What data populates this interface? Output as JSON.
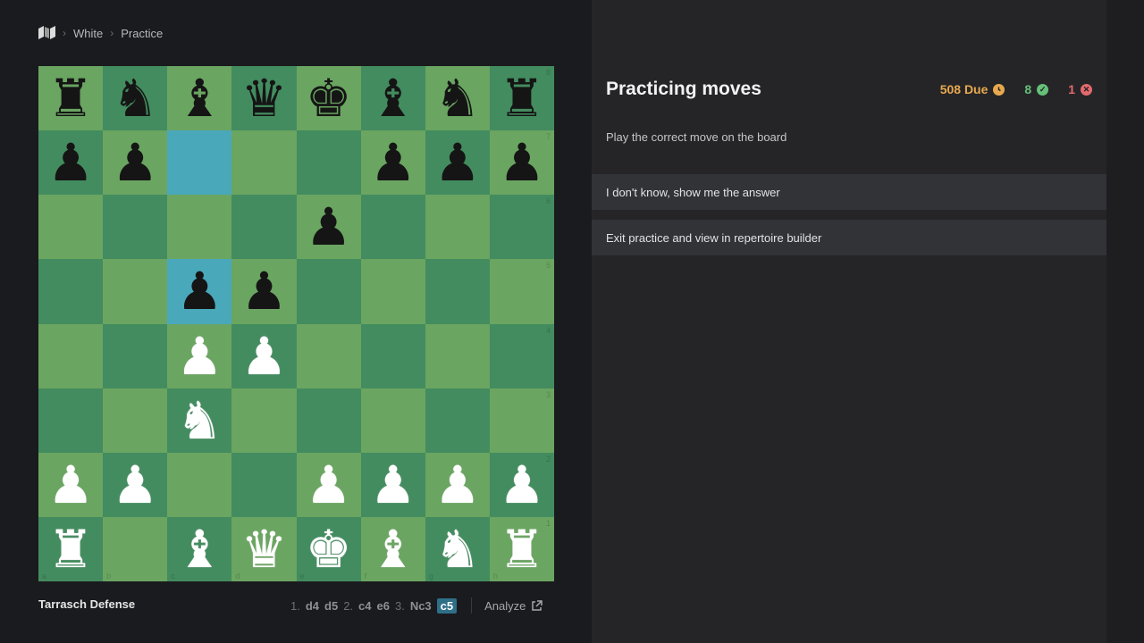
{
  "breadcrumb": {
    "items": [
      "White",
      "Practice"
    ]
  },
  "board": {
    "ranks": [
      "8",
      "7",
      "6",
      "5",
      "4",
      "3",
      "2",
      "1"
    ],
    "files": [
      "a",
      "b",
      "c",
      "d",
      "e",
      "f",
      "g",
      "h"
    ],
    "position": [
      [
        "r",
        "n",
        "b",
        "q",
        "k",
        "b",
        "n",
        "r"
      ],
      [
        "p",
        "p",
        "",
        "",
        "",
        "p",
        "p",
        "p"
      ],
      [
        "",
        "",
        "",
        "",
        "p",
        "",
        "",
        ""
      ],
      [
        "",
        "",
        "p",
        "p",
        "",
        "",
        "",
        ""
      ],
      [
        "",
        "",
        "P",
        "P",
        "",
        "",
        "",
        ""
      ],
      [
        "",
        "",
        "N",
        "",
        "",
        "",
        "",
        ""
      ],
      [
        "P",
        "P",
        "",
        "",
        "P",
        "P",
        "P",
        "P"
      ],
      [
        "R",
        "",
        "B",
        "Q",
        "K",
        "B",
        "N",
        "R"
      ]
    ],
    "highlight": [
      "c7",
      "c5"
    ],
    "colors": {
      "light": "#6aa561",
      "dark": "#438c5f",
      "highlight": "#4aa8bb"
    }
  },
  "opening_name": "Tarrasch Defense",
  "moves": [
    {
      "num": "1.",
      "white": "d4",
      "black": "d5"
    },
    {
      "num": "2.",
      "white": "c4",
      "black": "e6"
    },
    {
      "num": "3.",
      "white": "Nc3",
      "black": "c5"
    }
  ],
  "analyze_label": "Analyze",
  "panel": {
    "title": "Practicing moves",
    "due": "508 Due",
    "correct": "8",
    "incorrect": "1",
    "instruction": "Play the correct move on the board",
    "actions": [
      "I don't know, show me the answer",
      "Exit practice and view in repertoire builder"
    ]
  }
}
